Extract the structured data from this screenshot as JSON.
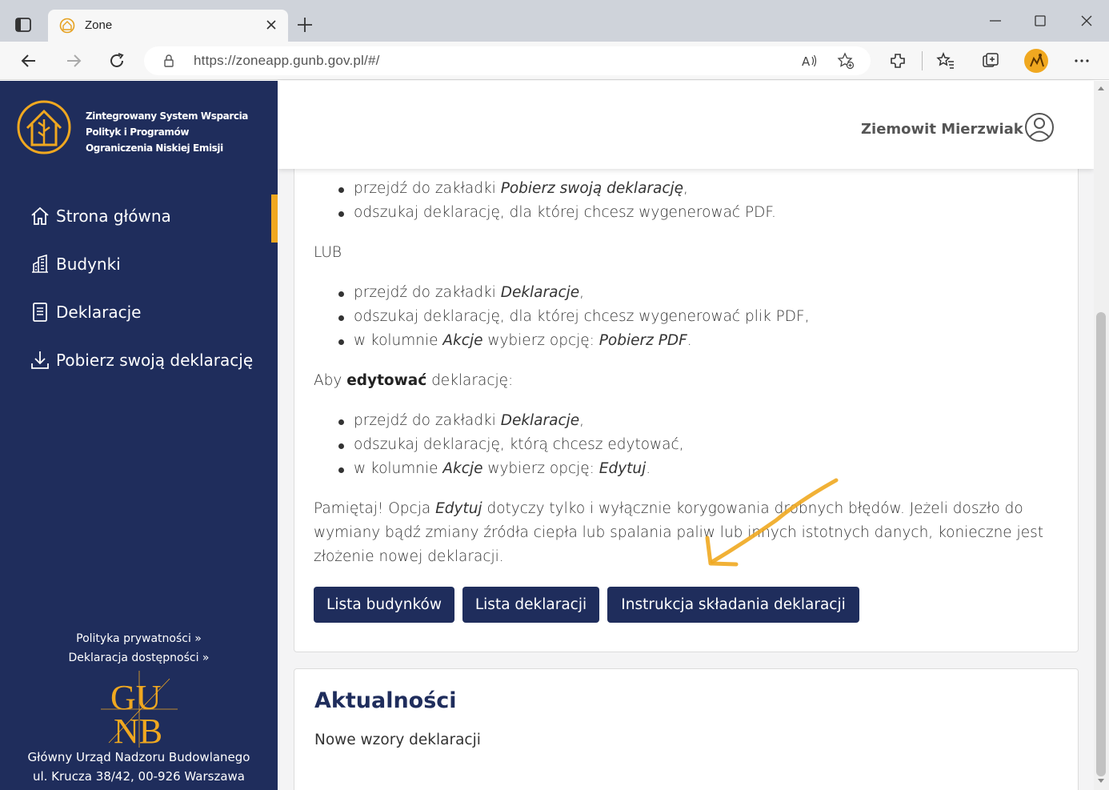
{
  "browser": {
    "tab_title": "Zone",
    "url": "https://zoneapp.gunb.gov.pl/#/",
    "icons": [
      "window-icon",
      "tab-favicon",
      "close-icon",
      "new-tab-icon",
      "minimize-icon",
      "maximize-icon",
      "window-close-icon",
      "back-icon",
      "forward-icon",
      "refresh-icon",
      "lock-icon",
      "read-aloud-icon",
      "add-favorite-icon",
      "extensions-icon",
      "favorites-icon",
      "collections-icon",
      "profile-avatar",
      "more-icon"
    ]
  },
  "sidebar": {
    "system_title": [
      "Zintegrowany System Wsparcia",
      "Polityk i Programów",
      "Ograniczenia Niskiej Emisji"
    ],
    "nav": [
      {
        "label": "Strona główna",
        "icon": "home-icon"
      },
      {
        "label": "Budynki",
        "icon": "building-icon"
      },
      {
        "label": "Deklaracje",
        "icon": "document-icon"
      },
      {
        "label": "Pobierz swoją deklarację",
        "icon": "download-icon"
      }
    ],
    "privacy_link": "Polityka prywatności »",
    "accessibility_link": "Deklaracja dostępności »",
    "gunb_logo_text": "GUNB",
    "footer_line1": "Główny Urząd Nadzoru Budowlanego",
    "footer_line2": "ul. Krucza 38/42, 00-926 Warszawa",
    "accent_color": "#f0a820",
    "bg_color": "#1f2d5c"
  },
  "header": {
    "user_name": "Ziemowit Mierzwiak"
  },
  "instructions": {
    "list1": [
      {
        "pre": "przejdź do zakładki ",
        "em": "Pobierz swoją deklarację",
        "post": ","
      },
      {
        "pre": "odszukaj deklarację, dla której chcesz wygenerować PDF.",
        "em": "",
        "post": ""
      }
    ],
    "or_text": "LUB",
    "list2": [
      {
        "pre": "przejdź do zakładki ",
        "em": "Deklaracje",
        "post": ","
      },
      {
        "pre": "odszukaj deklarację, dla której chcesz wygenerować plik PDF,",
        "em": "",
        "post": ""
      },
      {
        "pre": "w kolumnie ",
        "em": "Akcje",
        "post": " wybierz opcję: ",
        "em2": "Pobierz PDF",
        "post2": "."
      }
    ],
    "edit_intro_pre": "Aby ",
    "edit_intro_bold": "edytować",
    "edit_intro_post": " deklarację:",
    "list3": [
      {
        "pre": "przejdź do zakładki ",
        "em": "Deklaracje",
        "post": ","
      },
      {
        "pre": "odszukaj deklarację, którą chcesz edytować,",
        "em": "",
        "post": ""
      },
      {
        "pre": "w kolumnie ",
        "em": "Akcje",
        "post": " wybierz opcję: ",
        "em2": "Edytuj",
        "post2": "."
      }
    ],
    "note_line1_pre": "Pamiętaj! Opcja ",
    "note_line1_em": "Edytuj",
    "note_line1_post": " dotyczy tylko i wyłącznie korygowania drobnych błędów. Jeżeli doszło do",
    "note_line2": "wymiany bądź zmiany źródła ciepła lub spalania paliw lub innych istotnych danych, konieczne jest",
    "note_line3": "złożenie nowej deklaracji."
  },
  "buttons": {
    "buildings": "Lista budynków",
    "declarations": "Lista deklaracji",
    "instructions": "Instrukcja składania deklaracji"
  },
  "news": {
    "title": "Aktualności",
    "item": "Nowe wzory deklaracji"
  },
  "annotation": {
    "type": "arrow",
    "color": "#f0a820"
  }
}
